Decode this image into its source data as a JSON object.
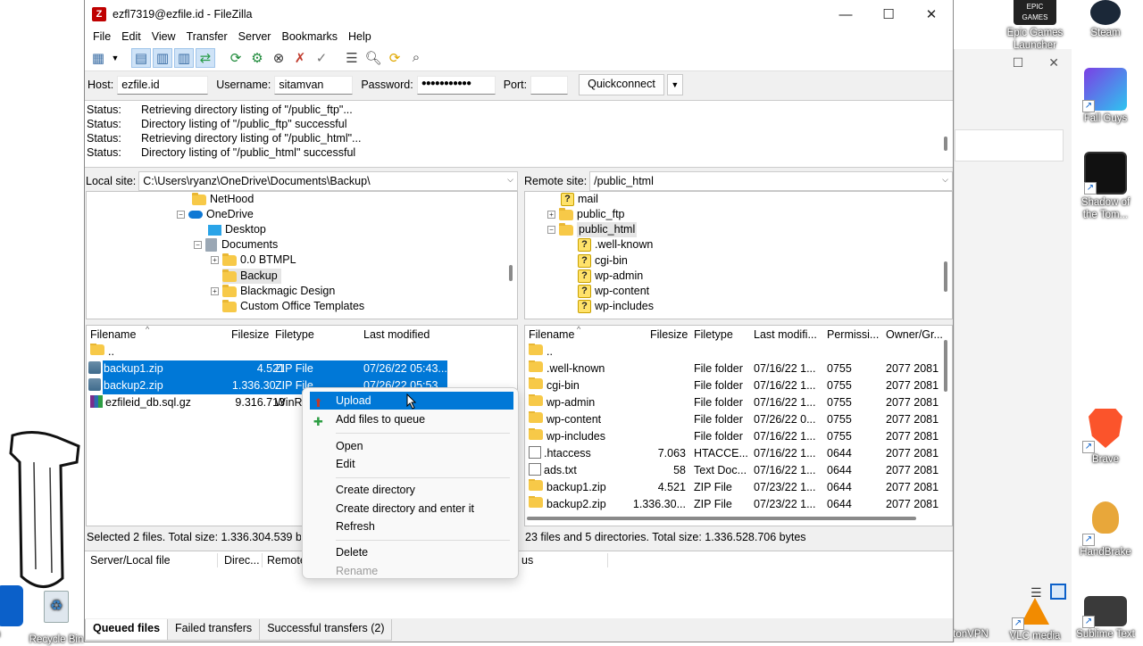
{
  "window": {
    "title": "ezfl7319@ezfile.id - FileZilla"
  },
  "menu": [
    "File",
    "Edit",
    "View",
    "Transfer",
    "Server",
    "Bookmarks",
    "Help"
  ],
  "quickconnect": {
    "host_label": "Host:",
    "host_value": "ezfile.id",
    "username_label": "Username:",
    "username_value": "sitamvan",
    "password_label": "Password:",
    "password_value": "●●●●●●●●●●●",
    "port_label": "Port:",
    "port_value": "",
    "button": "Quickconnect"
  },
  "log": [
    {
      "k": "Status:",
      "v": "Retrieving directory listing of \"/public_ftp\"..."
    },
    {
      "k": "Status:",
      "v": "Directory listing of \"/public_ftp\" successful"
    },
    {
      "k": "Status:",
      "v": "Retrieving directory listing of \"/public_html\"..."
    },
    {
      "k": "Status:",
      "v": "Directory listing of \"/public_html\" successful"
    }
  ],
  "local": {
    "site_label": "Local site:",
    "path": "C:\\Users\\ryanz\\OneDrive\\Documents\\Backup\\",
    "tree": [
      "NetHood",
      "OneDrive",
      "Desktop",
      "Documents",
      "0.0 BTMPL",
      "Backup",
      "Blackmagic Design",
      "Custom Office Templates"
    ],
    "headers": {
      "name": "Filename",
      "size": "Filesize",
      "type": "Filetype",
      "modified": "Last modified"
    },
    "files": [
      {
        "name": "..",
        "size": "",
        "type": "",
        "modified": ""
      },
      {
        "name": "backup1.zip",
        "size": "4.521",
        "type": "ZIP File",
        "modified": "07/26/22 05:43..."
      },
      {
        "name": "backup2.zip",
        "size": "1.336.30...",
        "type": "ZIP File",
        "modified": "07/26/22 05:53..."
      },
      {
        "name": "ezfileid_db.sql.gz",
        "size": "9.316.713",
        "type": "WinR...",
        "modified": ""
      }
    ],
    "status": "Selected 2 files. Total size: 1.336.304.539 bytes"
  },
  "remote": {
    "site_label": "Remote site:",
    "path": "/public_html",
    "tree": [
      "mail",
      "public_ftp",
      "public_html",
      ".well-known",
      "cgi-bin",
      "wp-admin",
      "wp-content",
      "wp-includes"
    ],
    "headers": {
      "name": "Filename",
      "size": "Filesize",
      "type": "Filetype",
      "modified": "Last modifi...",
      "perm": "Permissi...",
      "owner": "Owner/Gr..."
    },
    "files": [
      {
        "name": "..",
        "size": "",
        "type": "",
        "modified": "",
        "perm": "",
        "owner": ""
      },
      {
        "name": ".well-known",
        "size": "",
        "type": "File folder",
        "modified": "07/16/22 1...",
        "perm": "0755",
        "owner": "2077 2081"
      },
      {
        "name": "cgi-bin",
        "size": "",
        "type": "File folder",
        "modified": "07/16/22 1...",
        "perm": "0755",
        "owner": "2077 2081"
      },
      {
        "name": "wp-admin",
        "size": "",
        "type": "File folder",
        "modified": "07/16/22 1...",
        "perm": "0755",
        "owner": "2077 2081"
      },
      {
        "name": "wp-content",
        "size": "",
        "type": "File folder",
        "modified": "07/26/22 0...",
        "perm": "0755",
        "owner": "2077 2081"
      },
      {
        "name": "wp-includes",
        "size": "",
        "type": "File folder",
        "modified": "07/16/22 1...",
        "perm": "0755",
        "owner": "2077 2081"
      },
      {
        "name": ".htaccess",
        "size": "7.063",
        "type": "HTACCE...",
        "modified": "07/16/22 1...",
        "perm": "0644",
        "owner": "2077 2081"
      },
      {
        "name": "ads.txt",
        "size": "58",
        "type": "Text Doc...",
        "modified": "07/16/22 1...",
        "perm": "0644",
        "owner": "2077 2081"
      },
      {
        "name": "backup1.zip",
        "size": "4.521",
        "type": "ZIP File",
        "modified": "07/23/22 1...",
        "perm": "0644",
        "owner": "2077 2081"
      },
      {
        "name": "backup2.zip",
        "size": "1.336.30...",
        "type": "ZIP File",
        "modified": "07/23/22 1...",
        "perm": "0644",
        "owner": "2077 2081"
      }
    ],
    "status": "23 files and 5 directories. Total size: 1.336.528.706 bytes"
  },
  "queue": {
    "headers": [
      "Server/Local file",
      "Direc...",
      "Remote",
      "us"
    ],
    "tabs": [
      "Queued files",
      "Failed transfers",
      "Successful transfers (2)"
    ]
  },
  "context_menu": [
    "Upload",
    "Add files to queue",
    "Open",
    "Edit",
    "Create directory",
    "Create directory and enter it",
    "Refresh",
    "Delete",
    "Rename"
  ],
  "desktop_icons": [
    "Epic Games Launcher",
    "Steam",
    "Fall Guys",
    "Shadow of the Tom...",
    "Brave",
    "HandBrake",
    "Recycle Bin",
    "VLC media",
    "Sublime Text",
    "tonVPN",
    "en"
  ],
  "colors": {
    "selection": "#0078d7",
    "accent_filezilla": "#bf0000"
  }
}
